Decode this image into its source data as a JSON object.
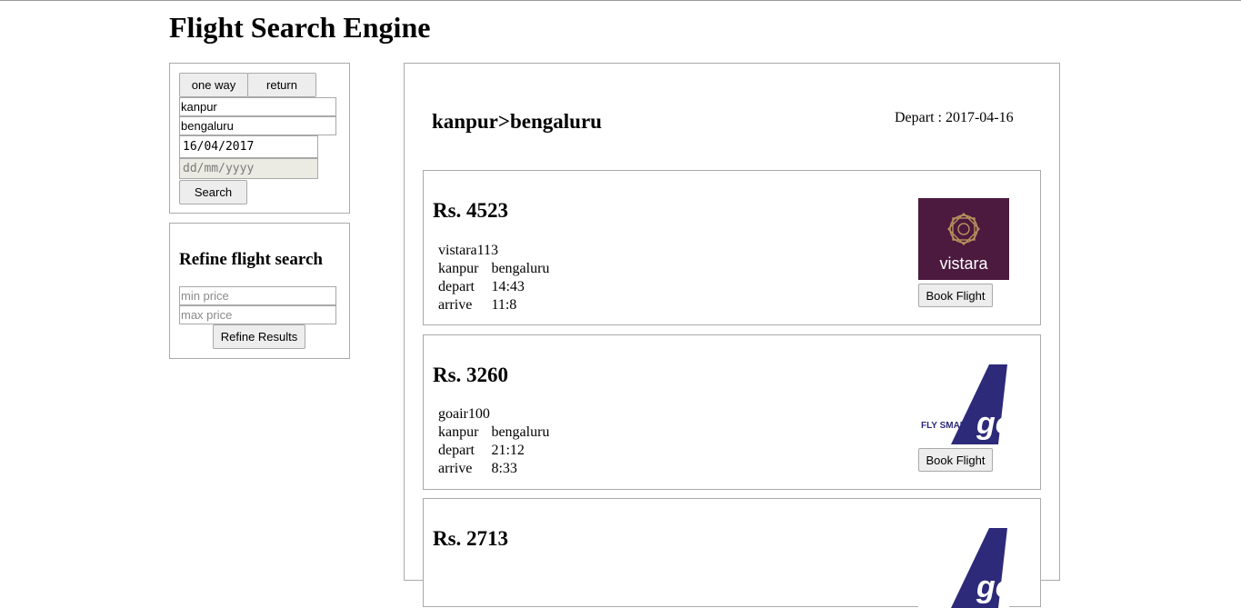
{
  "app": {
    "title": "Flight Search Engine"
  },
  "search": {
    "one_way_label": "one way",
    "return_label": "return",
    "origin_value": "kanpur",
    "destination_value": "bengaluru",
    "depart_date_value": "16/04/2017",
    "return_date_placeholder": "dd/mm/yyyy",
    "search_label": "Search"
  },
  "refine": {
    "title": "Refine flight search",
    "min_price_placeholder": "min price",
    "max_price_placeholder": "max price",
    "button_label": "Refine Results"
  },
  "results": {
    "route": "kanpur>bengaluru",
    "depart_label": "Depart : 2017-04-16",
    "flights": [
      {
        "price": "Rs. 4523",
        "code": "vistara113",
        "from": "kanpur",
        "to": "bengaluru",
        "depart_label": "depart",
        "depart_time": "14:43",
        "arrive_label": "arrive",
        "arrive_time": "11:8",
        "logo_icon": "vistara-logo",
        "logo_text": "vistara",
        "book_label": "Book Flight"
      },
      {
        "price": "Rs. 3260",
        "code": "goair100",
        "from": "kanpur",
        "to": "bengaluru",
        "depart_label": "depart",
        "depart_time": "21:12",
        "arrive_label": "arrive",
        "arrive_time": "8:33",
        "logo_icon": "goair-logo",
        "logo_text": "FLY SMART",
        "book_label": "Book Flight"
      },
      {
        "price": "Rs. 2713",
        "logo_icon": "goair-logo"
      }
    ]
  },
  "colors": {
    "vistara_bg": "#4b1a3e",
    "vistara_gold": "#b9935c",
    "goair_blue": "#2d2a7a",
    "button_bg": "#ededed",
    "border": "#aaaaaa",
    "disabled_bg": "#ebebe4"
  }
}
